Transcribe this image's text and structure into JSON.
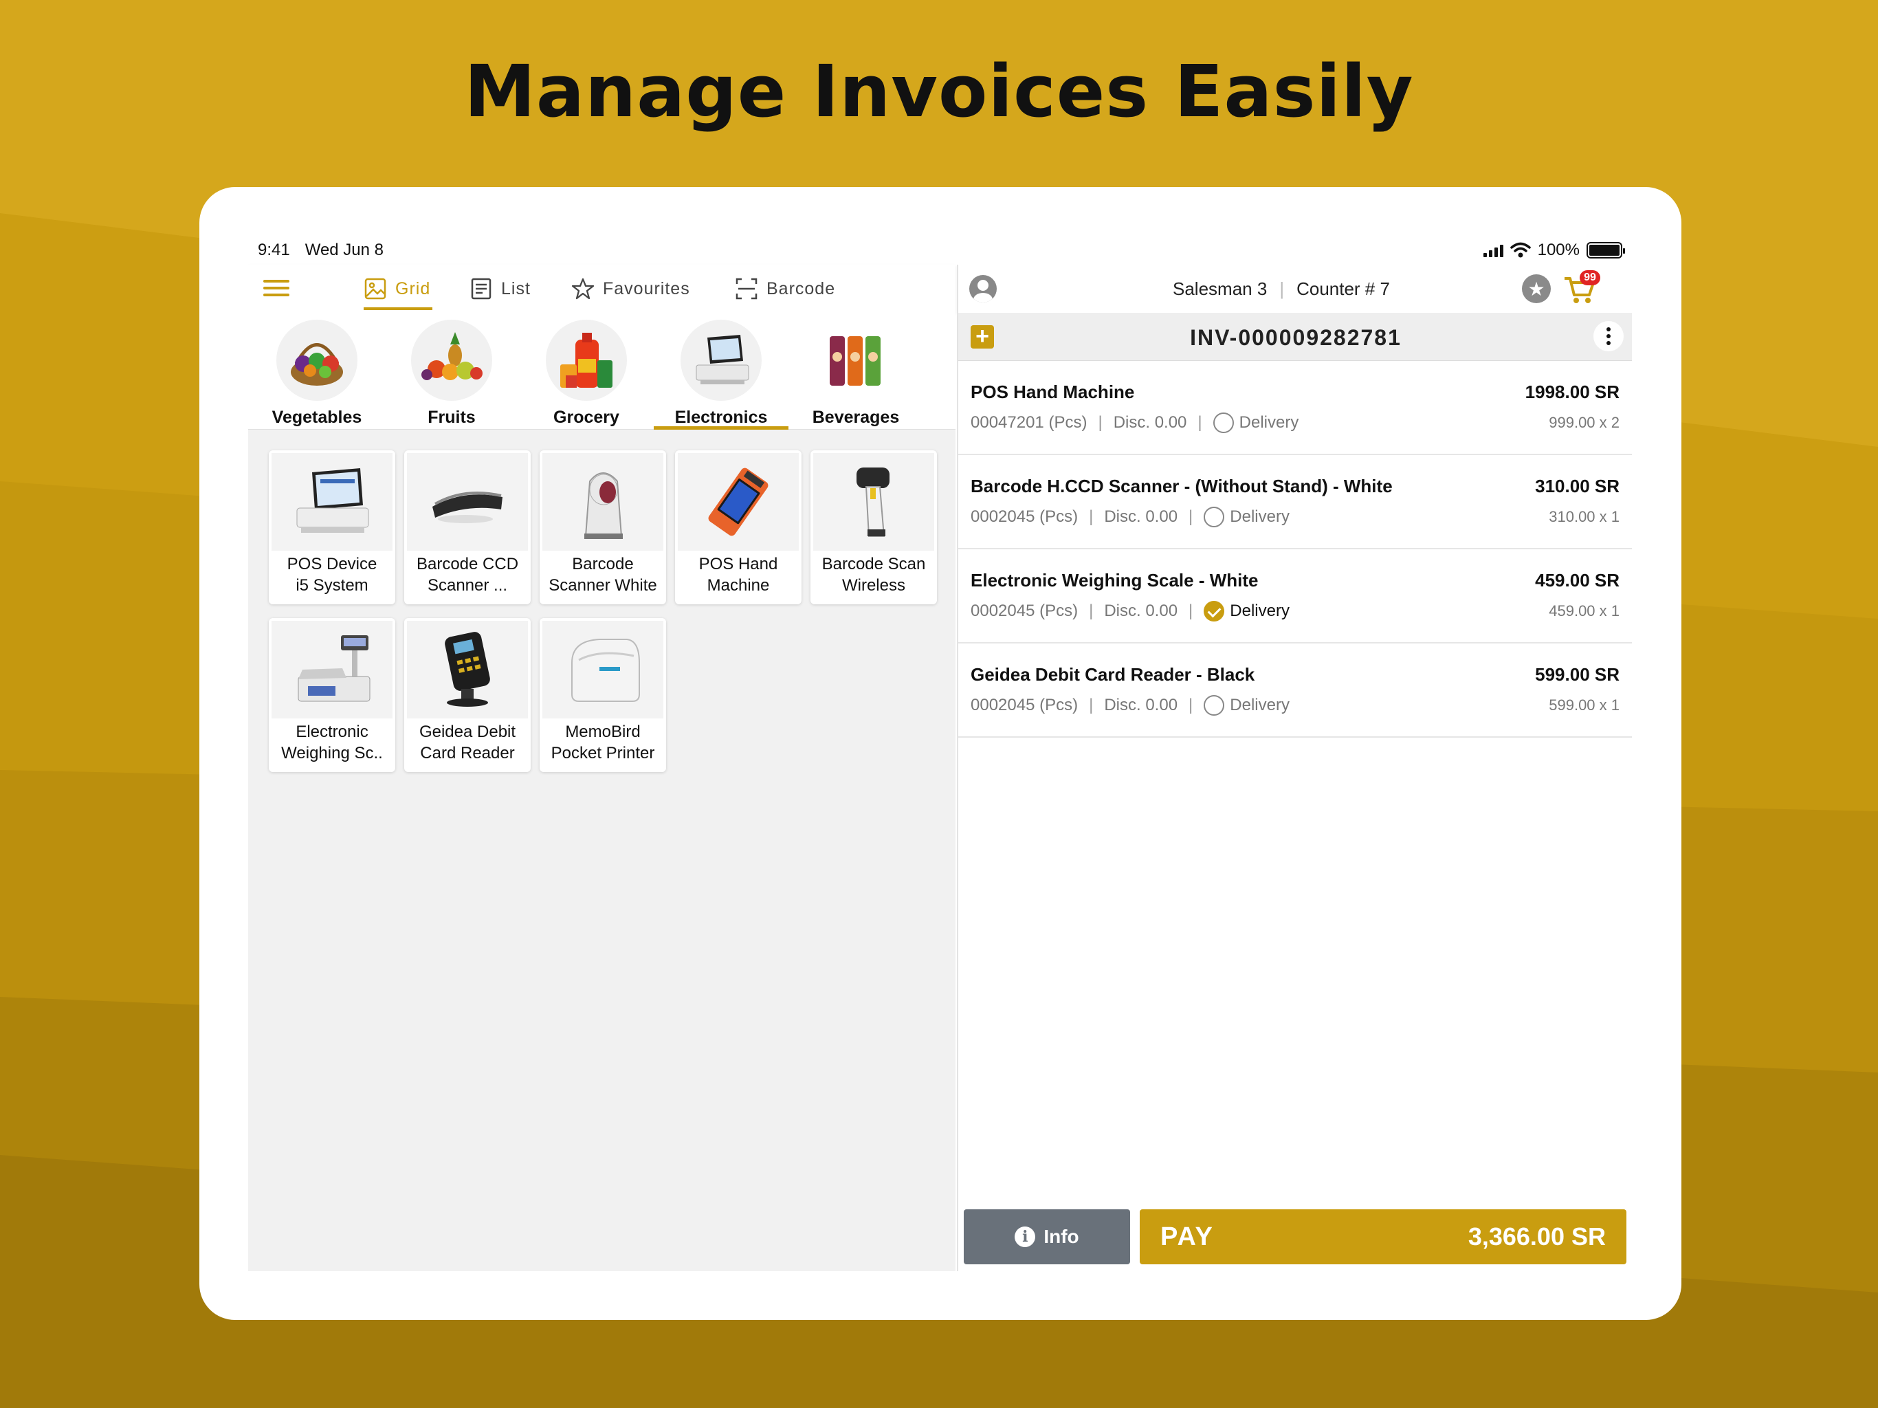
{
  "headline": "Manage Invoices Easily",
  "status": {
    "time": "9:41",
    "date": "Wed Jun 8",
    "battery": "100%"
  },
  "tabs": [
    {
      "label": "Grid",
      "icon": "image-icon",
      "active": true
    },
    {
      "label": "List",
      "icon": "list-icon",
      "active": false
    },
    {
      "label": "Favourites",
      "icon": "star-outline-icon",
      "active": false
    },
    {
      "label": "Barcode",
      "icon": "barcode-scan-icon",
      "active": false
    }
  ],
  "categories": [
    {
      "label": "Vegetables",
      "icon": "vegetables-basket-icon",
      "active": false
    },
    {
      "label": "Fruits",
      "icon": "fruits-icon",
      "active": false
    },
    {
      "label": "Grocery",
      "icon": "grocery-bottles-icon",
      "active": false
    },
    {
      "label": "Electronics",
      "icon": "pos-terminal-icon",
      "active": true
    },
    {
      "label": "Beverages",
      "icon": "beverage-cans-icon",
      "active": false
    }
  ],
  "products": [
    {
      "line1": "POS Device",
      "line2": "i5 System",
      "icon": "pos-device-icon"
    },
    {
      "line1": "Barcode CCD",
      "line2": "Scanner ...",
      "icon": "ccd-scanner-icon"
    },
    {
      "line1": "Barcode",
      "line2": "Scanner White",
      "icon": "barcode-scanner-white-icon"
    },
    {
      "line1": "POS Hand",
      "line2": "Machine",
      "icon": "pos-hand-machine-icon"
    },
    {
      "line1": "Barcode Scan",
      "line2": "Wireless",
      "icon": "wireless-scanner-icon"
    },
    {
      "line1": "Electronic",
      "line2": "Weighing Sc..",
      "icon": "weighing-scale-icon"
    },
    {
      "line1": "Geidea Debit",
      "line2": "Card Reader",
      "icon": "card-reader-icon"
    },
    {
      "line1": "MemoBird",
      "line2": "Pocket Printer",
      "icon": "pocket-printer-icon"
    }
  ],
  "header": {
    "salesman": "Salesman 3",
    "counter": "Counter # 7",
    "cart_count": "99"
  },
  "invoice": {
    "number": "INV-000009282781"
  },
  "items": [
    {
      "name": "POS Hand Machine",
      "total": "1998.00 SR",
      "code": "00047201 (Pcs)",
      "disc": "Disc. 0.00",
      "delivery": "Delivery",
      "delivery_on": false,
      "qty": "999.00 x 2"
    },
    {
      "name": "Barcode H.CCD Scanner - (Without Stand) - White",
      "total": "310.00 SR",
      "code": "0002045 (Pcs)",
      "disc": "Disc. 0.00",
      "delivery": "Delivery",
      "delivery_on": false,
      "qty": "310.00 x 1"
    },
    {
      "name": "Electronic Weighing Scale - White",
      "total": "459.00 SR",
      "code": "0002045 (Pcs)",
      "disc": "Disc. 0.00",
      "delivery": "Delivery",
      "delivery_on": true,
      "qty": "459.00 x 1"
    },
    {
      "name": "Geidea Debit Card Reader - Black",
      "total": "599.00 SR",
      "code": "0002045 (Pcs)",
      "disc": "Disc. 0.00",
      "delivery": "Delivery",
      "delivery_on": false,
      "qty": "599.00 x 1"
    }
  ],
  "footer": {
    "info_label": "Info",
    "pay_label": "PAY",
    "pay_total": "3,366.00 SR"
  },
  "colors": {
    "accent": "#c99d10",
    "background": "#c99d10",
    "info_button": "#69717a",
    "badge": "#e02424"
  }
}
